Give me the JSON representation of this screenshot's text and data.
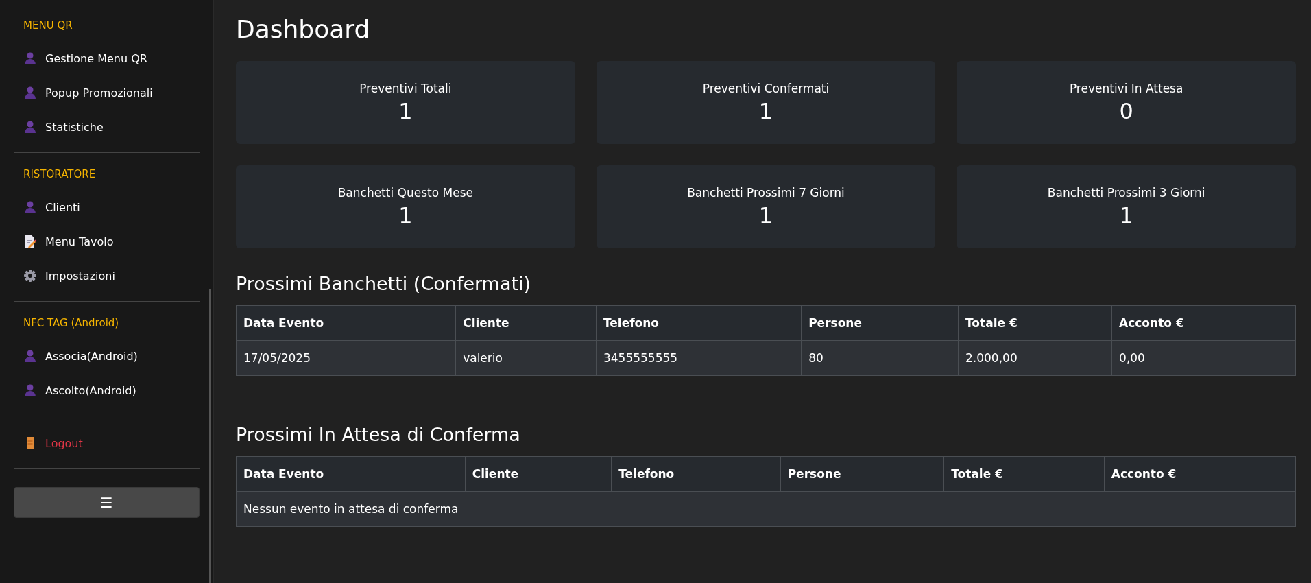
{
  "sidebar": {
    "sections": [
      {
        "title": "MENU QR",
        "items": [
          {
            "label": "Gestione Menu QR",
            "kind": "person"
          },
          {
            "label": "Popup Promozionali",
            "kind": "person"
          },
          {
            "label": "Statistiche",
            "kind": "person"
          }
        ]
      },
      {
        "title": "RISTORATORE",
        "items": [
          {
            "label": "Clienti",
            "kind": "person"
          },
          {
            "label": "Menu Tavolo",
            "kind": "document"
          },
          {
            "label": "Impostazioni",
            "kind": "gear"
          }
        ]
      },
      {
        "title": "NFC TAG (Android)",
        "items": [
          {
            "label": "Associa(Android)",
            "kind": "person"
          },
          {
            "label": "Ascolto(Android)",
            "kind": "person"
          }
        ]
      },
      {
        "items": [
          {
            "label": "Logout",
            "kind": "logout"
          }
        ]
      }
    ],
    "toggle_button": "☰"
  },
  "main": {
    "title": "Dashboard",
    "stats": [
      {
        "label": "Preventivi Totali",
        "value": "1"
      },
      {
        "label": "Preventivi Confermati",
        "value": "1"
      },
      {
        "label": "Preventivi In Attesa",
        "value": "0"
      },
      {
        "label": "Banchetti Questo Mese",
        "value": "1"
      },
      {
        "label": "Banchetti Prossimi 7 Giorni",
        "value": "1"
      },
      {
        "label": "Banchetti Prossimi 3 Giorni",
        "value": "1"
      }
    ],
    "tables": [
      {
        "title": "Prossimi Banchetti (Confermati)",
        "columns": [
          "Data Evento",
          "Cliente",
          "Telefono",
          "Persone",
          "Totale €",
          "Acconto €"
        ],
        "rows": [
          [
            "17/05/2025",
            "valerio",
            "3455555555",
            "80",
            "2.000,00",
            "0,00"
          ]
        ]
      },
      {
        "title": "Prossimi In Attesa di Conferma",
        "columns": [
          "Data Evento",
          "Cliente",
          "Telefono",
          "Persone",
          "Totale €",
          "Acconto €"
        ],
        "empty_message": "Nessun evento in attesa di conferma"
      }
    ]
  }
}
